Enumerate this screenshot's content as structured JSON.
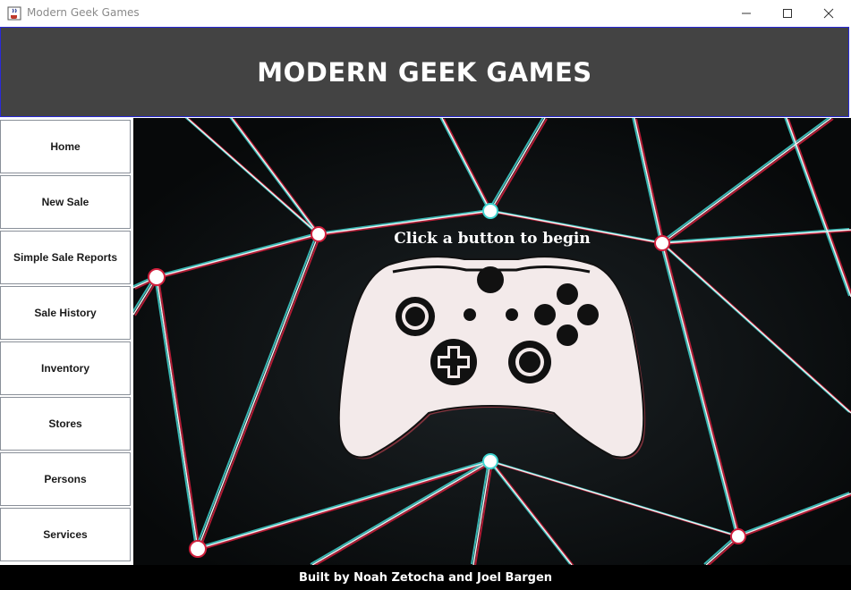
{
  "window": {
    "title": "Modern Geek Games",
    "icon": "java-cup-icon",
    "controls": [
      "minimize-icon",
      "maximize-icon",
      "close-icon"
    ]
  },
  "header": {
    "title": "MODERN GEEK GAMES"
  },
  "sidebar": {
    "items": [
      {
        "label": "Home"
      },
      {
        "label": "New Sale"
      },
      {
        "label": "Simple Sale Reports"
      },
      {
        "label": "Sale History"
      },
      {
        "label": "Inventory"
      },
      {
        "label": "Stores"
      },
      {
        "label": "Persons"
      },
      {
        "label": "Services"
      }
    ]
  },
  "main": {
    "prompt": "Click a button to begin",
    "background_image": "game-controller-network-image"
  },
  "footer": {
    "text": "Built by Noah Zetocha and Joel Bargen"
  },
  "colors": {
    "header_bg": "#434343",
    "header_border": "#2a2ad8",
    "footer_bg": "#000000",
    "nav_border": "#8a9099"
  }
}
